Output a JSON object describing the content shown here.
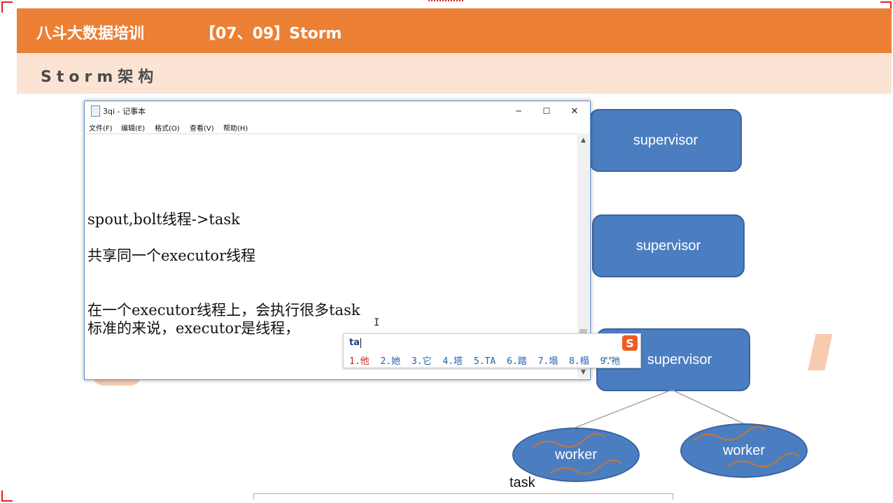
{
  "slide": {
    "brand": "八斗大数据培训",
    "course": "【07、09】Storm",
    "subtitle": "Storm架构"
  },
  "diagram": {
    "supervisors": [
      "supervisor",
      "supervisor",
      "supervisor"
    ],
    "workers": [
      "worker",
      "worker"
    ],
    "task_label": "task"
  },
  "notepad": {
    "title": "3qi - 记事本",
    "window_buttons": {
      "minimize": "─",
      "maximize": "☐",
      "close": "✕"
    },
    "menu": [
      "文件(F)",
      "编辑(E)",
      "格式(O)",
      "查看(V)",
      "帮助(H)"
    ],
    "lines": [
      "spout,bolt线程->task",
      "共享同一个executor线程",
      "在一个executor线程上，会执行很多task",
      "标准的来说，executor是线程，"
    ],
    "scroll_up": "▲",
    "scroll_down": "▼"
  },
  "ime": {
    "input": "ta",
    "logo": "S",
    "candidates": [
      "1.他",
      "2.她",
      "3.它",
      "4.塔",
      "5.TA",
      "6.踏",
      "7.塌",
      "8.榻",
      "9.祂"
    ],
    "pager": "◂ ▸"
  },
  "colors": {
    "header_orange": "#ec8034",
    "subheader_peach": "#fbe4d4",
    "node_blue": "#4b7ec1",
    "ime_first_candidate": "#d02020"
  }
}
